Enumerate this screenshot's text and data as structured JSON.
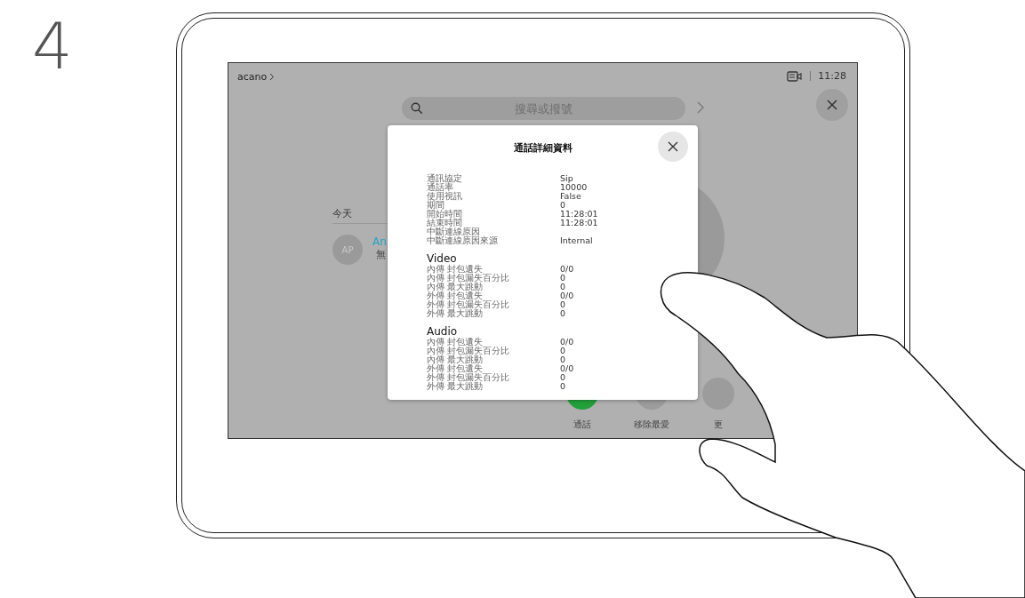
{
  "step": "4",
  "status_bar": {
    "brand": "acano",
    "time": "11:28"
  },
  "search": {
    "placeholder": "搜尋或撥號"
  },
  "history": {
    "section": "今天",
    "items": [
      {
        "initials": "AP",
        "name": "An",
        "detail": "無"
      }
    ]
  },
  "actions": [
    {
      "label": "通話",
      "kind": "call"
    },
    {
      "label": "移除最愛",
      "kind": "favorite"
    },
    {
      "label": "更",
      "kind": "more"
    }
  ],
  "dialog": {
    "title": "通話詳細資料",
    "rows": [
      {
        "label": "通訊協定",
        "value": "Sip"
      },
      {
        "label": "通話率",
        "value": "10000"
      },
      {
        "label": "使用視訊",
        "value": "False"
      },
      {
        "label": "期間",
        "value": "0"
      },
      {
        "label": "開始時間",
        "value": "11:28:01"
      },
      {
        "label": "結束時間",
        "value": "11:28:01"
      },
      {
        "label": "中斷連線原因"
      },
      {
        "label": "中斷連線原因來源",
        "value": "Internal"
      }
    ],
    "sections": [
      {
        "title": "Video",
        "rows": [
          {
            "label": "內傳 封包遺失",
            "value": "0/0"
          },
          {
            "label": "內傳 封包漏失百分比",
            "value": "0"
          },
          {
            "label": "內傳 最大跳動",
            "value": "0"
          },
          {
            "label": "外傳 封包遺失",
            "value": "0/0"
          },
          {
            "label": "外傳 封包漏失百分比",
            "value": "0"
          },
          {
            "label": "外傳 最大跳動",
            "value": "0"
          }
        ]
      },
      {
        "title": "Audio",
        "rows": [
          {
            "label": "內傳 封包遺失",
            "value": "0/0"
          },
          {
            "label": "內傳 封包漏失百分比",
            "value": "0"
          },
          {
            "label": "內傳 最大跳動",
            "value": "0"
          },
          {
            "label": "外傳 封包遺失",
            "value": "0/0"
          },
          {
            "label": "外傳 封包漏失百分比",
            "value": "0"
          },
          {
            "label": "外傳 最大跳動",
            "value": "0"
          }
        ]
      }
    ]
  }
}
